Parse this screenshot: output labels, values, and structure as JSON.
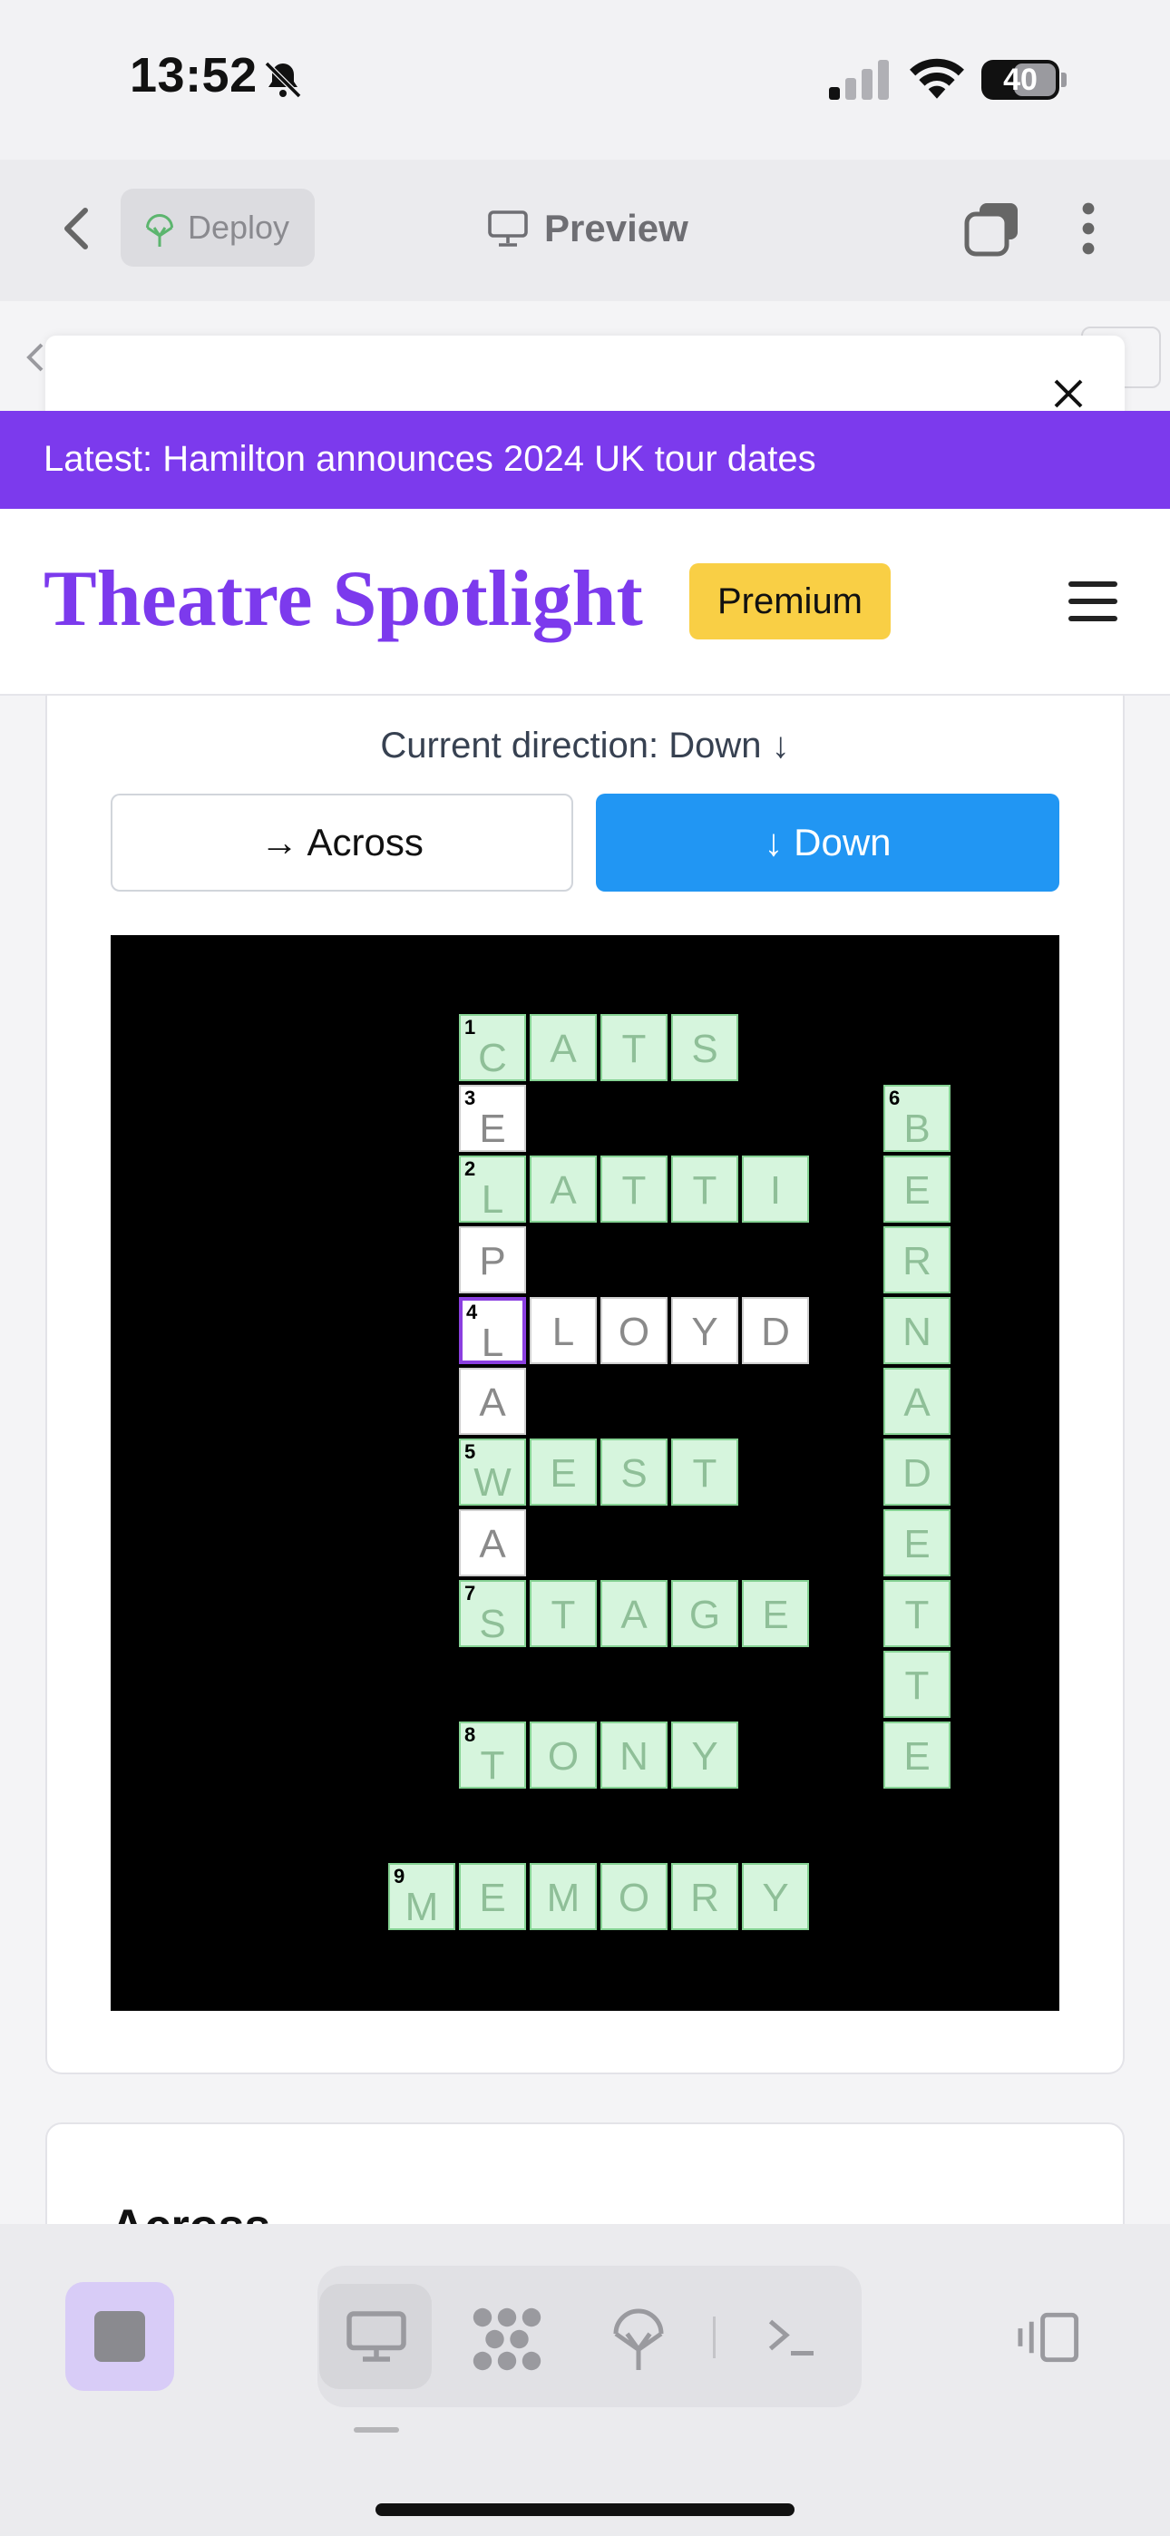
{
  "status_bar": {
    "time": "13:52",
    "battery": "40",
    "icons": [
      "bell-slash-icon",
      "signal-icon",
      "wifi-icon",
      "battery-icon"
    ]
  },
  "browser": {
    "deploy_label": "Deploy",
    "preview_label": "Preview"
  },
  "banner": {
    "text": "Latest: Hamilton announces 2024 UK tour dates"
  },
  "header": {
    "site_title": "Theatre Spotlight",
    "badge": "Premium"
  },
  "crossword": {
    "direction_text": "Current direction: Down ↓",
    "across_button": "→ Across",
    "down_button": "↓ Down",
    "cells": [
      {
        "r": 0,
        "c": 5,
        "ch": "C",
        "n": "1",
        "st": "green"
      },
      {
        "r": 0,
        "c": 6,
        "ch": "A",
        "st": "green"
      },
      {
        "r": 0,
        "c": 7,
        "ch": "T",
        "st": "green"
      },
      {
        "r": 0,
        "c": 8,
        "ch": "S",
        "st": "green"
      },
      {
        "r": 1,
        "c": 5,
        "ch": "E",
        "n": "3",
        "st": "white"
      },
      {
        "r": 1,
        "c": 11,
        "ch": "B",
        "n": "6",
        "st": "green"
      },
      {
        "r": 2,
        "c": 5,
        "ch": "L",
        "n": "2",
        "st": "green"
      },
      {
        "r": 2,
        "c": 6,
        "ch": "A",
        "st": "green"
      },
      {
        "r": 2,
        "c": 7,
        "ch": "T",
        "st": "green"
      },
      {
        "r": 2,
        "c": 8,
        "ch": "T",
        "st": "green"
      },
      {
        "r": 2,
        "c": 9,
        "ch": "I",
        "st": "green"
      },
      {
        "r": 2,
        "c": 11,
        "ch": "E",
        "st": "green"
      },
      {
        "r": 3,
        "c": 5,
        "ch": "P",
        "st": "white"
      },
      {
        "r": 3,
        "c": 11,
        "ch": "R",
        "st": "green"
      },
      {
        "r": 4,
        "c": 5,
        "ch": "L",
        "n": "4",
        "st": "sel"
      },
      {
        "r": 4,
        "c": 6,
        "ch": "L",
        "st": "white"
      },
      {
        "r": 4,
        "c": 7,
        "ch": "O",
        "st": "white"
      },
      {
        "r": 4,
        "c": 8,
        "ch": "Y",
        "st": "white"
      },
      {
        "r": 4,
        "c": 9,
        "ch": "D",
        "st": "white"
      },
      {
        "r": 4,
        "c": 11,
        "ch": "N",
        "st": "green"
      },
      {
        "r": 5,
        "c": 5,
        "ch": "A",
        "st": "white"
      },
      {
        "r": 5,
        "c": 11,
        "ch": "A",
        "st": "green"
      },
      {
        "r": 6,
        "c": 5,
        "ch": "W",
        "n": "5",
        "st": "green"
      },
      {
        "r": 6,
        "c": 6,
        "ch": "E",
        "st": "green"
      },
      {
        "r": 6,
        "c": 7,
        "ch": "S",
        "st": "green"
      },
      {
        "r": 6,
        "c": 8,
        "ch": "T",
        "st": "green"
      },
      {
        "r": 6,
        "c": 11,
        "ch": "D",
        "st": "green"
      },
      {
        "r": 7,
        "c": 5,
        "ch": "A",
        "st": "white"
      },
      {
        "r": 7,
        "c": 11,
        "ch": "E",
        "st": "green"
      },
      {
        "r": 8,
        "c": 5,
        "ch": "S",
        "n": "7",
        "st": "green"
      },
      {
        "r": 8,
        "c": 6,
        "ch": "T",
        "st": "green"
      },
      {
        "r": 8,
        "c": 7,
        "ch": "A",
        "st": "green"
      },
      {
        "r": 8,
        "c": 8,
        "ch": "G",
        "st": "green"
      },
      {
        "r": 8,
        "c": 9,
        "ch": "E",
        "st": "green"
      },
      {
        "r": 8,
        "c": 11,
        "ch": "T",
        "st": "green"
      },
      {
        "r": 9,
        "c": 11,
        "ch": "T",
        "st": "green"
      },
      {
        "r": 10,
        "c": 5,
        "ch": "T",
        "n": "8",
        "st": "green"
      },
      {
        "r": 10,
        "c": 6,
        "ch": "O",
        "st": "green"
      },
      {
        "r": 10,
        "c": 7,
        "ch": "N",
        "st": "green"
      },
      {
        "r": 10,
        "c": 8,
        "ch": "Y",
        "st": "green"
      },
      {
        "r": 10,
        "c": 11,
        "ch": "E",
        "st": "green"
      },
      {
        "r": 12,
        "c": 4,
        "ch": "M",
        "n": "9",
        "st": "green"
      },
      {
        "r": 12,
        "c": 5,
        "ch": "E",
        "st": "green"
      },
      {
        "r": 12,
        "c": 6,
        "ch": "M",
        "st": "green"
      },
      {
        "r": 12,
        "c": 7,
        "ch": "O",
        "st": "green"
      },
      {
        "r": 12,
        "c": 8,
        "ch": "R",
        "st": "green"
      },
      {
        "r": 12,
        "c": 9,
        "ch": "Y",
        "st": "green"
      }
    ]
  },
  "clues_heading": "Across",
  "colors": {
    "accent": "#7c3aed",
    "button_blue": "#2196f3",
    "premium": "#f9cf45",
    "cell_green": "#d6f5dd"
  }
}
